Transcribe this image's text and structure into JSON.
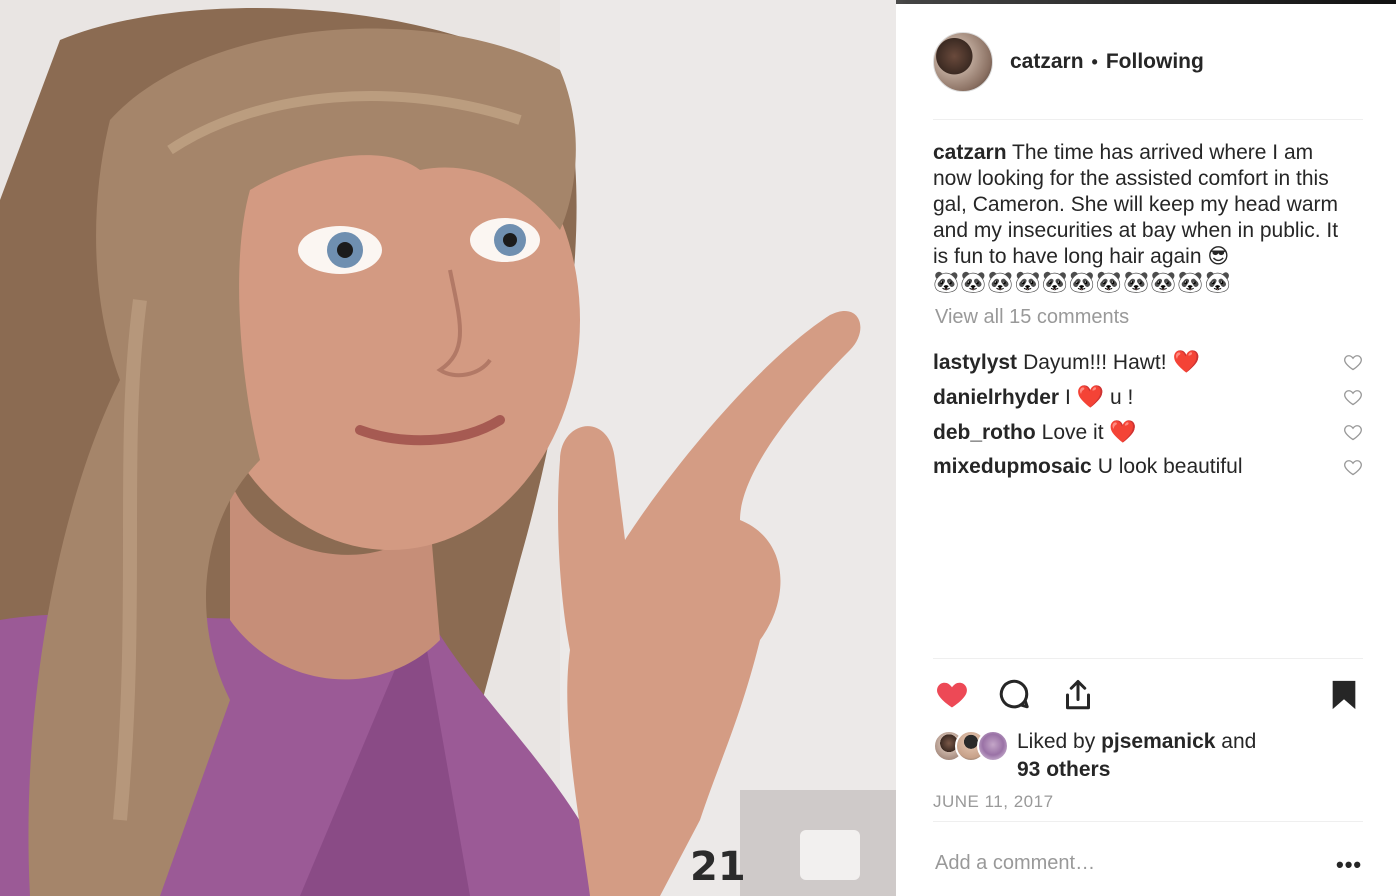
{
  "post": {
    "username": "catzarn",
    "separator": "•",
    "follow_status": "Following",
    "caption_text": "The time has arrived where I am now looking for the assisted comfort in this gal, Cameron. She will keep my head warm and my insecurities at bay when in public. It is fun to have long hair again 😎",
    "caption_emojis": "🐼🐼🐼🐼🐼🐼🐼🐼🐼🐼🐼",
    "view_all_comments": "View all 15 comments"
  },
  "comments": [
    {
      "user": "lastylyst",
      "text": "Dayum!!! Hawt! ",
      "emoji": "❤️"
    },
    {
      "user": "danielrhyder",
      "text": "I ",
      "emoji": "❤️",
      "text_after": " u !"
    },
    {
      "user": "deb_rotho",
      "text": "Love it ",
      "emoji": "❤️"
    },
    {
      "user": "mixedupmosaic",
      "text": "U look beautiful",
      "emoji": ""
    }
  ],
  "actions": {
    "like_icon": "heart-filled-icon",
    "comment_icon": "comment-bubble-icon",
    "share_icon": "share-upload-icon",
    "save_icon": "bookmark-filled-icon"
  },
  "likes": {
    "prefix": "Liked by ",
    "user": "pjsemanick",
    "middle": " and",
    "others": "93 others"
  },
  "date": "JUNE 11, 2017",
  "add_comment_placeholder": "Add a comment…",
  "more_options": "•••",
  "colors": {
    "like_red": "#ed4956",
    "text": "#262626",
    "muted": "#999999",
    "separator": "#efefef"
  }
}
